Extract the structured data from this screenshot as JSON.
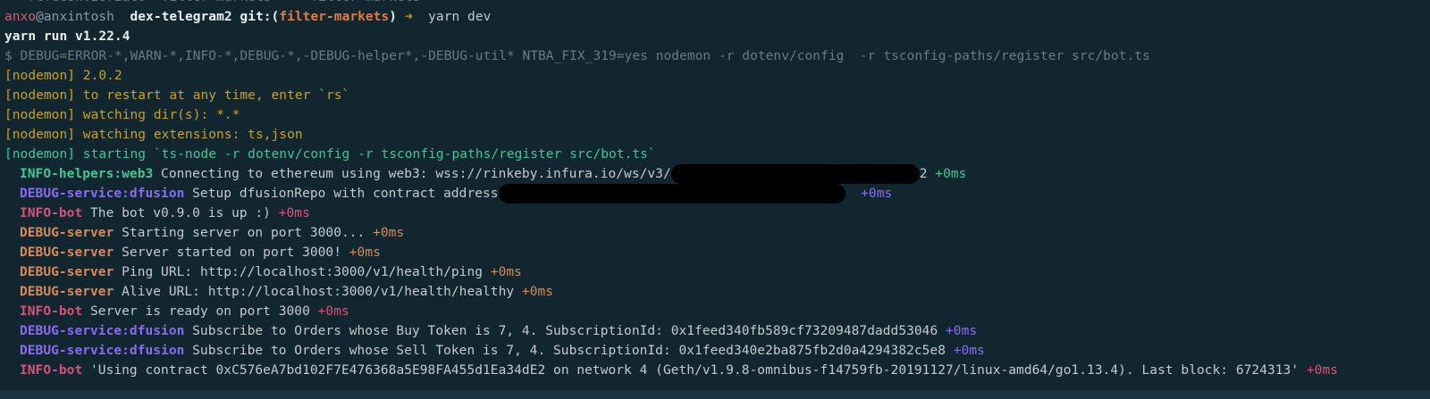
{
  "prompt": {
    "top_partial": "   rcfecsn:zoriaco  filter-markets  →  filter-markets",
    "user": "anxo",
    "host": "@anxintosh",
    "dir": "dex-telegram2",
    "git_label": "git:(",
    "branch": "filter-markets",
    "git_close": ")",
    "arrow": "➜",
    "command": "yarn dev"
  },
  "lines": {
    "yarn_version": "yarn run v1.22.4",
    "script": "$ DEBUG=ERROR-*,WARN-*,INFO-*,DEBUG-*,-DEBUG-helper*,-DEBUG-util* NTBA_FIX_319=yes nodemon -r dotenv/config  -r tsconfig-paths/register src/bot.ts",
    "nodemon_version": "[nodemon] 2.0.2",
    "nodemon_restart": "[nodemon] to restart at any time, enter `rs`",
    "nodemon_watch_dirs": "[nodemon] watching dir(s): *.*",
    "nodemon_watch_ext": "[nodemon] watching extensions: ts,json",
    "nodemon_starting": "[nodemon] starting `ts-node -r dotenv/config -r tsconfig-paths/register src/bot.ts`"
  },
  "logs": [
    {
      "tag": "INFO-helpers:web3",
      "msg": "Connecting to ethereum using web3: wss://rinkeby.infura.io/ws/v3/",
      "redacted": true,
      "after": "2",
      "time": "+0ms",
      "color": "green"
    },
    {
      "tag": "DEBUG-service:dfusion",
      "msg": "Setup dfusionRepo with contract address",
      "redacted": true,
      "after": " ",
      "time": "+0ms",
      "color": "purple"
    },
    {
      "tag": "INFO-bot",
      "msg": "The bot v0.9.0 is up :)",
      "time": "+0ms",
      "color": "pink"
    },
    {
      "tag": "DEBUG-server",
      "msg": "Starting server on port 3000...",
      "time": "+0ms",
      "color": "tan"
    },
    {
      "tag": "DEBUG-server",
      "msg": "Server started on port 3000!",
      "time": "+0ms",
      "color": "tan"
    },
    {
      "tag": "DEBUG-server",
      "msg": "Ping URL: http://localhost:3000/v1/health/ping",
      "time": "+0ms",
      "color": "tan"
    },
    {
      "tag": "DEBUG-server",
      "msg": "Alive URL: http://localhost:3000/v1/health/healthy",
      "time": "+0ms",
      "color": "tan"
    },
    {
      "tag": "INFO-bot",
      "msg": "Server is ready on port 3000",
      "time": "+0ms",
      "color": "pink"
    },
    {
      "tag": "DEBUG-service:dfusion",
      "msg": "Subscribe to Orders whose Buy Token is 7, 4. SubscriptionId: 0x1feed340fb589cf73209487dadd53046",
      "time": "+0ms",
      "color": "purple"
    },
    {
      "tag": "DEBUG-service:dfusion",
      "msg": "Subscribe to Orders whose Sell Token is 7, 4. SubscriptionId: 0x1feed340e2ba875fb2d0a4294382c5e8",
      "time": "+0ms",
      "color": "purple"
    },
    {
      "tag": "INFO-bot",
      "msg": "'Using contract 0xC576eA7bd102F7E476368a5E98FA455d1Ea34dE2 on network 4 (Geth/v1.9.8-omnibus-f14759fb-20191127/linux-amd64/go1.13.4). Last block: 6724313'",
      "time": "+0ms",
      "color": "pink"
    }
  ],
  "colors": {
    "background": "#11262f",
    "green": "#3fc79a",
    "purple": "#8a6cf2",
    "pink": "#d8527a",
    "tan": "#d98a5a",
    "yellow": "#c9a227"
  }
}
